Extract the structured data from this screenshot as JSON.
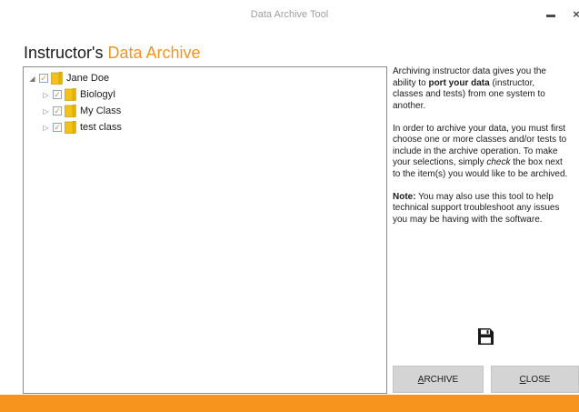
{
  "window": {
    "title": "Data Archive Tool",
    "minimize_label": "minimize",
    "close_glyph": "×"
  },
  "heading": {
    "prefix": "Instructor's",
    "accent": "Data Archive"
  },
  "tree": {
    "root": {
      "label": "Jane Doe",
      "checked": true,
      "expanded": true
    },
    "children": [
      {
        "label": "BiologyI",
        "checked": true,
        "expanded": false
      },
      {
        "label": "My Class",
        "checked": true,
        "expanded": false
      },
      {
        "label": "test class",
        "checked": true,
        "expanded": false
      }
    ]
  },
  "info": {
    "p1_a": "Archiving instructor data gives you the",
    "p1_b": "ability to ",
    "p1_bold": "port your data",
    "p1_c": " (instructor,",
    "p1_d": "classes and tests) from one system to",
    "p1_e": "another.",
    "p2_a": "In order to archive your data, you must first",
    "p2_b": "choose one or more classes and/or tests to",
    "p2_c": "include in the archive operation. To make",
    "p2_d1": "your selections, simply ",
    "p2_d_em": "check",
    "p2_d2": " the box next",
    "p2_e": "to the item(s) you would like to be archived.",
    "p3_bold": "Note:",
    "p3_a": " You may also use this tool to help",
    "p3_b": "technical support troubleshoot any issues",
    "p3_c": "you may be having with the software."
  },
  "buttons": {
    "archive_first": "A",
    "archive_rest": "RCHIVE",
    "close_first": "C",
    "close_rest": "LOSE"
  },
  "colors": {
    "accent": "#f7941d",
    "check": "#f08a24",
    "folder": "#f2c21a",
    "button_bg": "#d4d4d4"
  },
  "icons": {
    "save": "floppy-disk-icon",
    "folder": "folder-icon",
    "expander": "tree-expander-icon"
  }
}
